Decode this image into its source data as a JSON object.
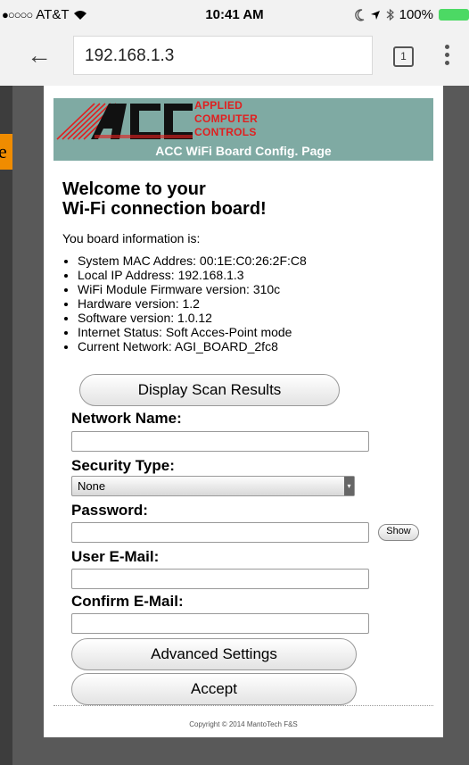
{
  "status_bar": {
    "signal": "●○○○○",
    "carrier": "AT&T",
    "wifi_icon": "wifi-icon",
    "time": "10:41 AM",
    "icons": [
      "moon-icon",
      "location-icon",
      "bluetooth-icon"
    ],
    "battery_text": "100%",
    "battery_color": "#4cd964"
  },
  "browser": {
    "url": "192.168.1.3",
    "tab_count": "1"
  },
  "side_tab_text": "e",
  "header": {
    "logo_letters": "ACC",
    "logo_line1": "APPLIED",
    "logo_line2": "COMPUTER",
    "logo_line3": "CONTROLS",
    "title": "ACC WiFi Board Config. Page",
    "bg_color": "#7faaa3",
    "logo_red": "#e02020"
  },
  "welcome": {
    "line1": "Welcome to your",
    "line2": "Wi-Fi connection board!"
  },
  "info_intro": "You board information is:",
  "info_items": [
    "System MAC Addres: 00:1E:C0:26:2F:C8",
    "Local IP Address: 192.168.1.3",
    "WiFi Module Firmware version: 310c",
    "Hardware version: 1.2",
    "Software version: 1.0.12",
    "Internet Status: Soft Acces-Point mode",
    "Current Network: AGI_BOARD_2fc8"
  ],
  "buttons": {
    "scan": "Display Scan Results",
    "show": "Show",
    "advanced": "Advanced Settings",
    "accept": "Accept"
  },
  "form": {
    "network_label": "Network Name:",
    "network_value": "",
    "security_label": "Security Type:",
    "security_value": "None",
    "password_label": "Password:",
    "password_value": "",
    "email_label": "User E-Mail:",
    "email_value": "",
    "confirm_label": "Confirm E-Mail:",
    "confirm_value": ""
  },
  "footer": {
    "copyright": "Copyright © 2014 MantoTech F&S"
  }
}
